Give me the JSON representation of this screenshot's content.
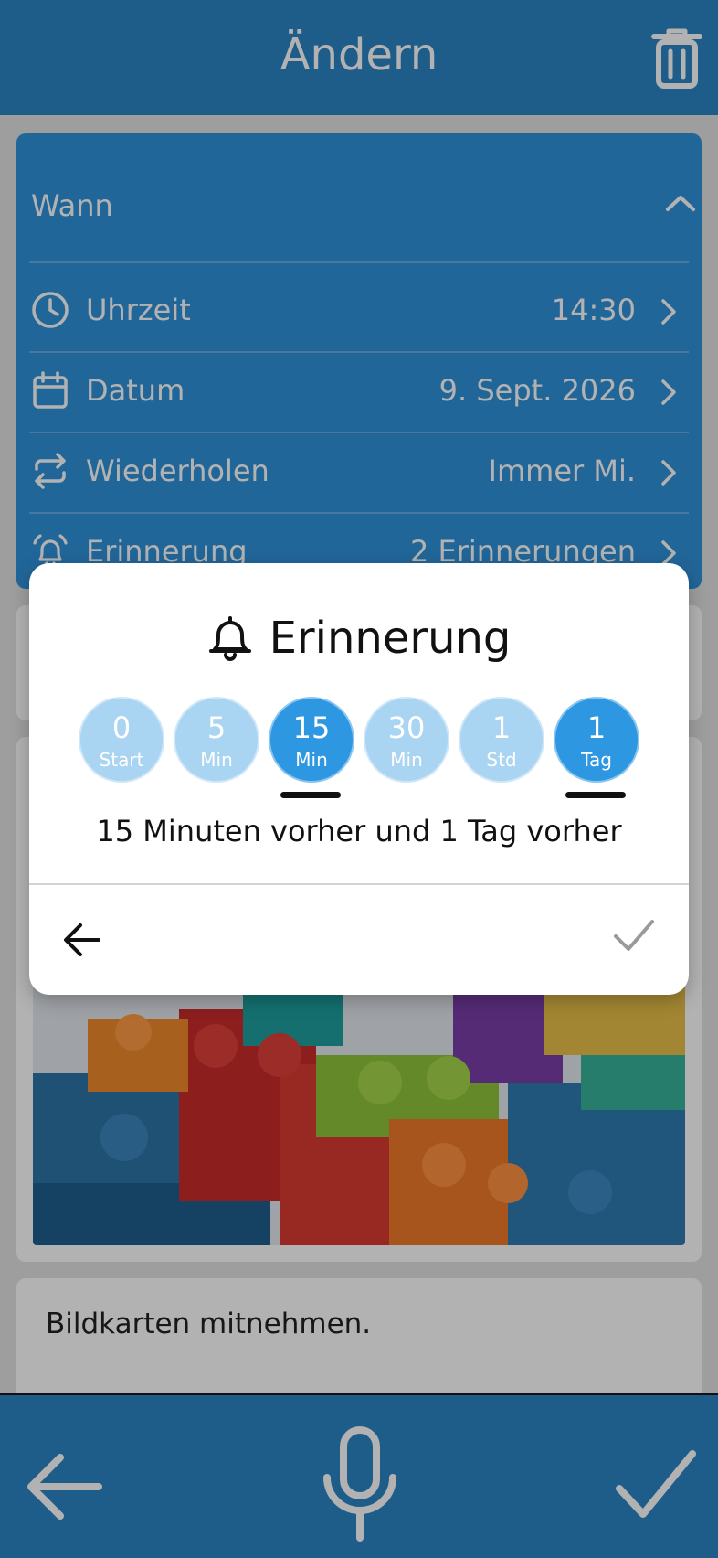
{
  "header": {
    "title": "Ändern",
    "trash_icon": "trash-icon"
  },
  "when": {
    "title": "Wann",
    "rows": [
      {
        "label": "Uhrzeit",
        "value": "14:30",
        "icon": "clock-icon"
      },
      {
        "label": "Datum",
        "value": "9. Sept. 2026",
        "icon": "calendar-icon"
      },
      {
        "label": "Wiederholen",
        "value": "Immer Mi.",
        "icon": "repeat-icon"
      },
      {
        "label": "Erinnerung",
        "value": "2 Erinnerungen",
        "icon": "alarm-bell-icon"
      }
    ]
  },
  "note": {
    "text": "Bildkarten mitnehmen."
  },
  "dialog": {
    "title": "Erinnerung",
    "options": [
      {
        "num": "0",
        "unit": "Start",
        "selected": false
      },
      {
        "num": "5",
        "unit": "Min",
        "selected": false
      },
      {
        "num": "15",
        "unit": "Min",
        "selected": true
      },
      {
        "num": "30",
        "unit": "Min",
        "selected": false
      },
      {
        "num": "1",
        "unit": "Std",
        "selected": false
      },
      {
        "num": "1",
        "unit": "Tag",
        "selected": true
      }
    ],
    "summary": "15 Minuten vorher und 1 Tag vorher"
  },
  "colors": {
    "header_blue": "#2b86c5",
    "card_blue": "#3093dc",
    "chip_selected": "#2e97e2",
    "chip_unselected": "#a9d4f2"
  }
}
